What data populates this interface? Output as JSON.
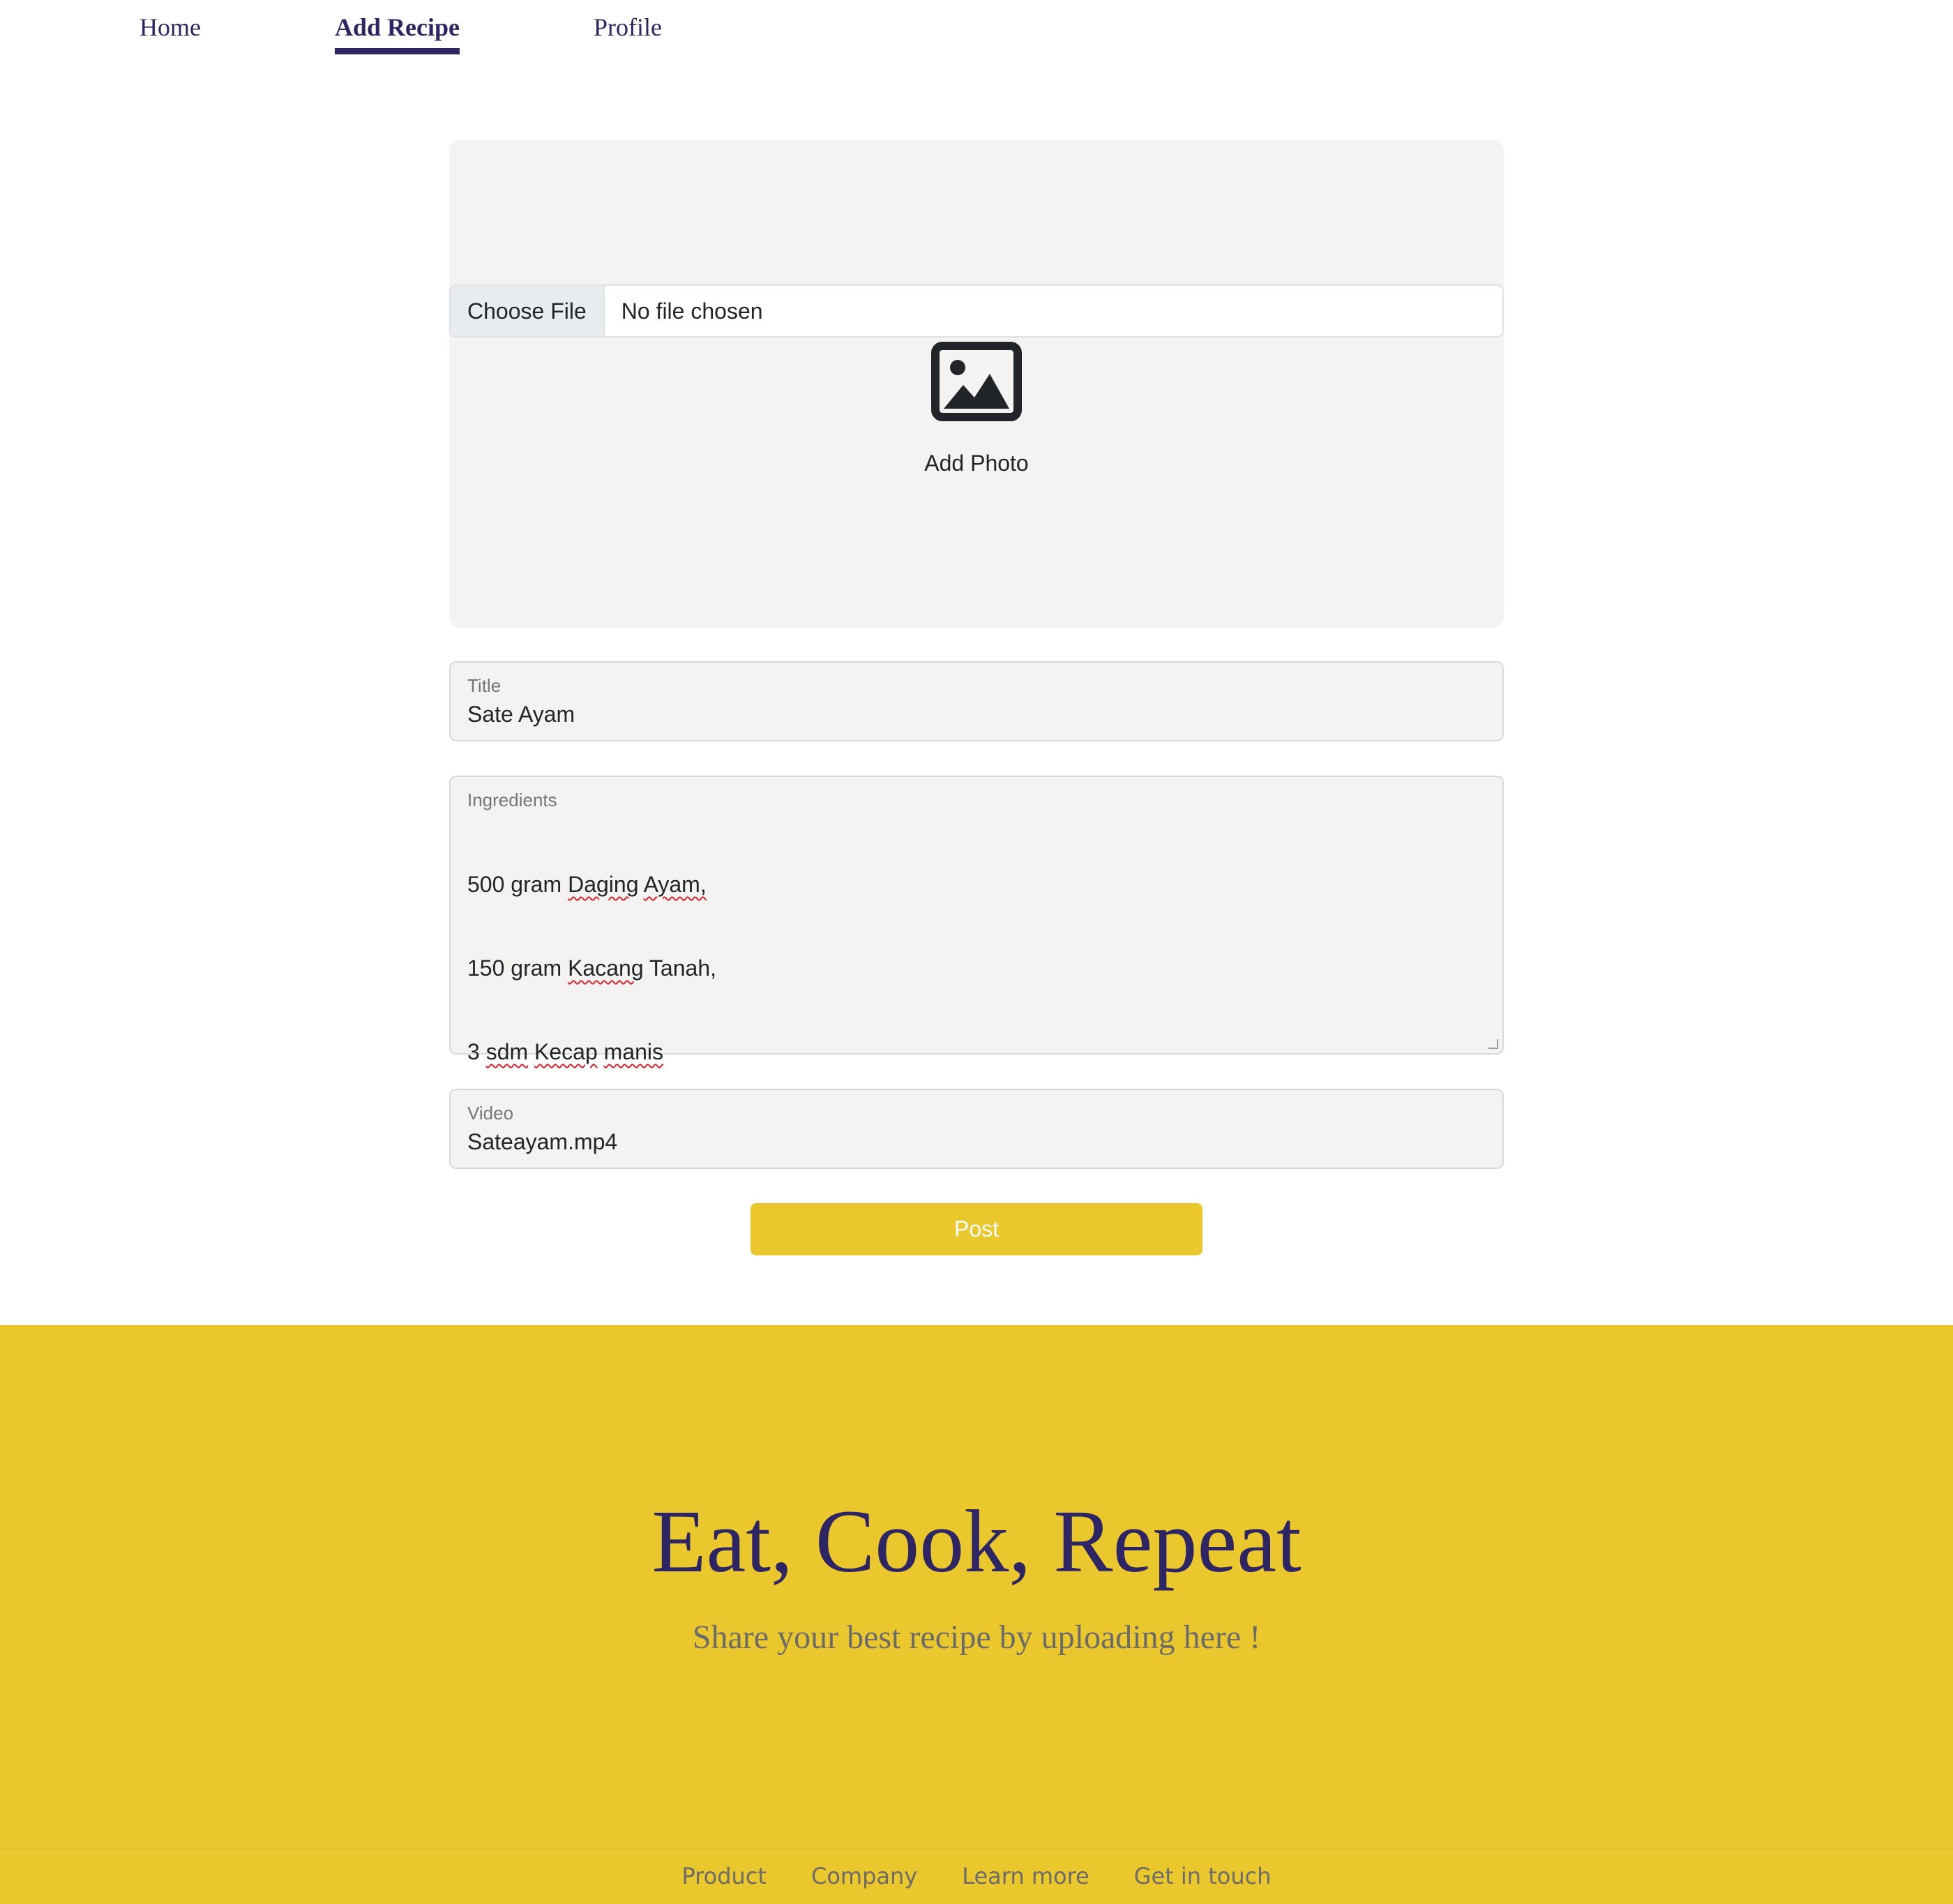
{
  "nav": {
    "items": [
      {
        "label": "Home",
        "active": false
      },
      {
        "label": "Add Recipe",
        "active": true
      },
      {
        "label": "Profile",
        "active": false
      }
    ]
  },
  "photo_upload": {
    "choose_file_label": "Choose File",
    "file_status": "No file chosen",
    "icon": "image-icon",
    "add_photo_label": "Add Photo"
  },
  "form": {
    "title": {
      "label": "Title",
      "value": "Sate Ayam"
    },
    "ingredients": {
      "label": "Ingredients",
      "lines": [
        "500 gram Daging Ayam,",
        "150 gram Kacang Tanah,",
        "3 sdm Kecap manis"
      ]
    },
    "video": {
      "label": "Video",
      "value": "Sateayam.mp4"
    },
    "post_label": "Post"
  },
  "footer": {
    "title": "Eat, Cook, Repeat",
    "subtitle": "Share your best recipe by uploading here !",
    "links": [
      "Product",
      "Company",
      "Learn more",
      "Get in touch"
    ]
  },
  "colors": {
    "accent": "#ebc72e",
    "brand_dark": "#2e2664",
    "field_bg": "#f4f3f1"
  }
}
